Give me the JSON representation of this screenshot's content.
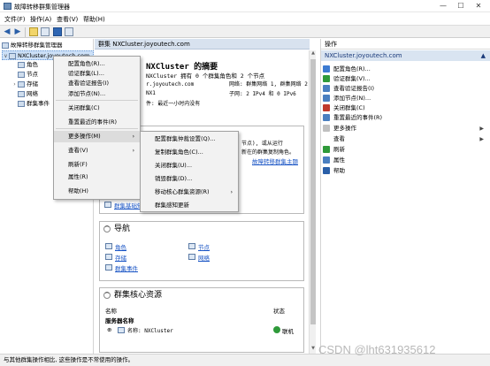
{
  "window": {
    "title": "故障转移群集管理器",
    "minimize": "—",
    "maximize": "☐",
    "close": "✕"
  },
  "menu": [
    "文件(F)",
    "操作(A)",
    "查看(V)",
    "帮助(H)"
  ],
  "tree": {
    "root": "故障转移群集管理器",
    "cluster": "NXCluster.joyoutech.com",
    "children": [
      "角色",
      "节点",
      "存储",
      "网络",
      "群集事件"
    ]
  },
  "center": {
    "header": "群集 NXCluster.joyoutech.com",
    "summary_title": "NXCluster 的摘要",
    "summary_sub": "NXCluster 拥有 0 个群集角色和 2 个节点",
    "line1": "r.joyoutech.com",
    "line2": "NX1",
    "line3": "件: 最近一小时内没有",
    "net_line1": "网络:  群集网络 1, 群集网络 2",
    "net_line2": "子网:  2 IPv4 和 0 IPv6",
    "frag1": "节点), 或从运行",
    "frag2": "新在的群集复制角色。",
    "frag3": "故障转移群集主题",
    "bottom_link": "群集基础知识"
  },
  "nav": {
    "title": "导航",
    "links": [
      "角色",
      "节点",
      "存储",
      "网络",
      "群集事件"
    ]
  },
  "core": {
    "title": "群集核心资源",
    "col_name": "名称",
    "col_status": "状态",
    "server_header": "服务器名称",
    "row_name": "名称: NXCluster",
    "row_status": "联机",
    "expand": "⊕"
  },
  "actions": {
    "header": "操作",
    "sub_header": "NXCluster.joyoutech.com",
    "items": [
      {
        "label": "配置角色(R)...",
        "icon": "configure-role-icon",
        "color": "#3d7bd1"
      },
      {
        "label": "验证群集(V)...",
        "icon": "validate-icon",
        "color": "#2f9a3a"
      },
      {
        "label": "查看验证报告(I)",
        "icon": "report-icon",
        "color": "#4a7fc0"
      },
      {
        "label": "添加节点(N)...",
        "icon": "add-node-icon",
        "color": "#4a7fc0"
      },
      {
        "label": "关闭群集(C)",
        "icon": "shutdown-icon",
        "color": "#c0392b"
      },
      {
        "label": "重置最近的事件(R)",
        "icon": "reset-events-icon",
        "color": "#4a7fc0"
      },
      {
        "label": "更多操作",
        "icon": "more-actions-icon",
        "color": "#c0c0c0",
        "arrow": "▶"
      },
      {
        "label": "查看",
        "icon": "",
        "color": "#ffffff",
        "arrow": "▶"
      },
      {
        "label": "刷新",
        "icon": "refresh-icon",
        "color": "#2f9a3a"
      },
      {
        "label": "属性",
        "icon": "properties-icon",
        "color": "#4a7fc0"
      },
      {
        "label": "帮助",
        "icon": "help-icon",
        "color": "#2a5fa8"
      }
    ]
  },
  "context_menu": {
    "items": [
      "配置角色(R)...",
      "验证群集(L)...",
      "查看验证报告(I)",
      "添加节点(N)...",
      "关闭群集(C)",
      "重置最近的事件(R)",
      "更多操作(M)",
      "查看(V)",
      "刷新(F)",
      "属性(R)",
      "帮助(H)"
    ]
  },
  "submenu": {
    "items": [
      "配置群集仲裁设置(Q)...",
      "复制群集角色(C)...",
      "关闭群集(U)...",
      "销毁群集(D)...",
      "移动核心群集资源(R)",
      "群集感知更新"
    ]
  },
  "status": "与其他群集操作相比, 这些操作是不常使用的操作。",
  "watermark": "CSDN @lht631935612"
}
